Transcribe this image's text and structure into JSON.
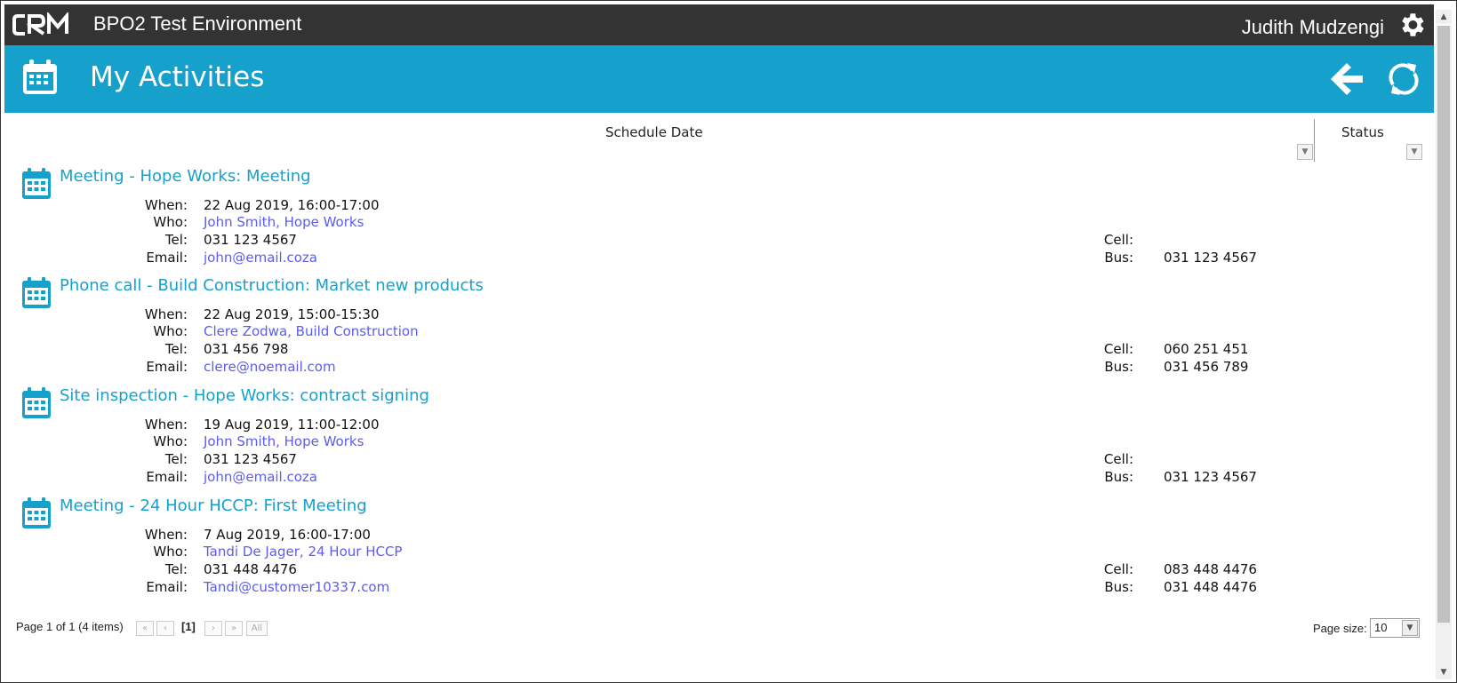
{
  "app": {
    "logo_text": "CRM",
    "environment": "BPO2 Test Environment",
    "user_name": "Judith Mudzengi",
    "page_title": "My Activities",
    "colors": {
      "topbar": "#333333",
      "titlebar": "#16a1cc",
      "link": "#5c5cf0",
      "activity_title": "#16a1cc"
    },
    "icons": {
      "settings": "gear-icon",
      "back": "arrow-left-icon",
      "refresh": "refresh-icon",
      "calendar": "calendar-icon"
    }
  },
  "columns": {
    "schedule_date": "Schedule Date",
    "status": "Status"
  },
  "labels": {
    "when": "When:",
    "who": "Who:",
    "tel": "Tel:",
    "email": "Email:",
    "cell": "Cell:",
    "bus": "Bus:"
  },
  "activities": [
    {
      "title": "Meeting - Hope Works: Meeting",
      "when": "22 Aug 2019, 16:00-17:00",
      "who": "John Smith, Hope Works",
      "tel": "031 123 4567",
      "email": "john@email.coza",
      "cell": "",
      "bus": "031 123 4567"
    },
    {
      "title": "Phone call - Build Construction: Market new products",
      "when": "22 Aug 2019, 15:00-15:30",
      "who": "Clere Zodwa, Build Construction",
      "tel": "031 456 798",
      "email": "clere@noemail.com",
      "cell": "060 251 451",
      "bus": "031 456 789"
    },
    {
      "title": "Site inspection - Hope Works: contract signing",
      "when": "19 Aug 2019, 11:00-12:00",
      "who": "John Smith, Hope Works",
      "tel": "031 123 4567",
      "email": "john@email.coza",
      "cell": "",
      "bus": "031 123 4567"
    },
    {
      "title": "Meeting - 24 Hour HCCP: First Meeting",
      "when": "7 Aug 2019, 16:00-17:00",
      "who": "Tandi De Jager, 24 Hour HCCP",
      "tel": "031 448 4476",
      "email": "Tandi@customer10337.com",
      "cell": "083 448 4476",
      "bus": "031 448 4476"
    }
  ],
  "pager": {
    "summary": "Page 1 of 1 (4 items)",
    "first": "«",
    "prev": "‹",
    "current": "[1]",
    "next": "›",
    "last": "»",
    "all": "All",
    "page_size_label": "Page size:",
    "page_size": "10"
  }
}
